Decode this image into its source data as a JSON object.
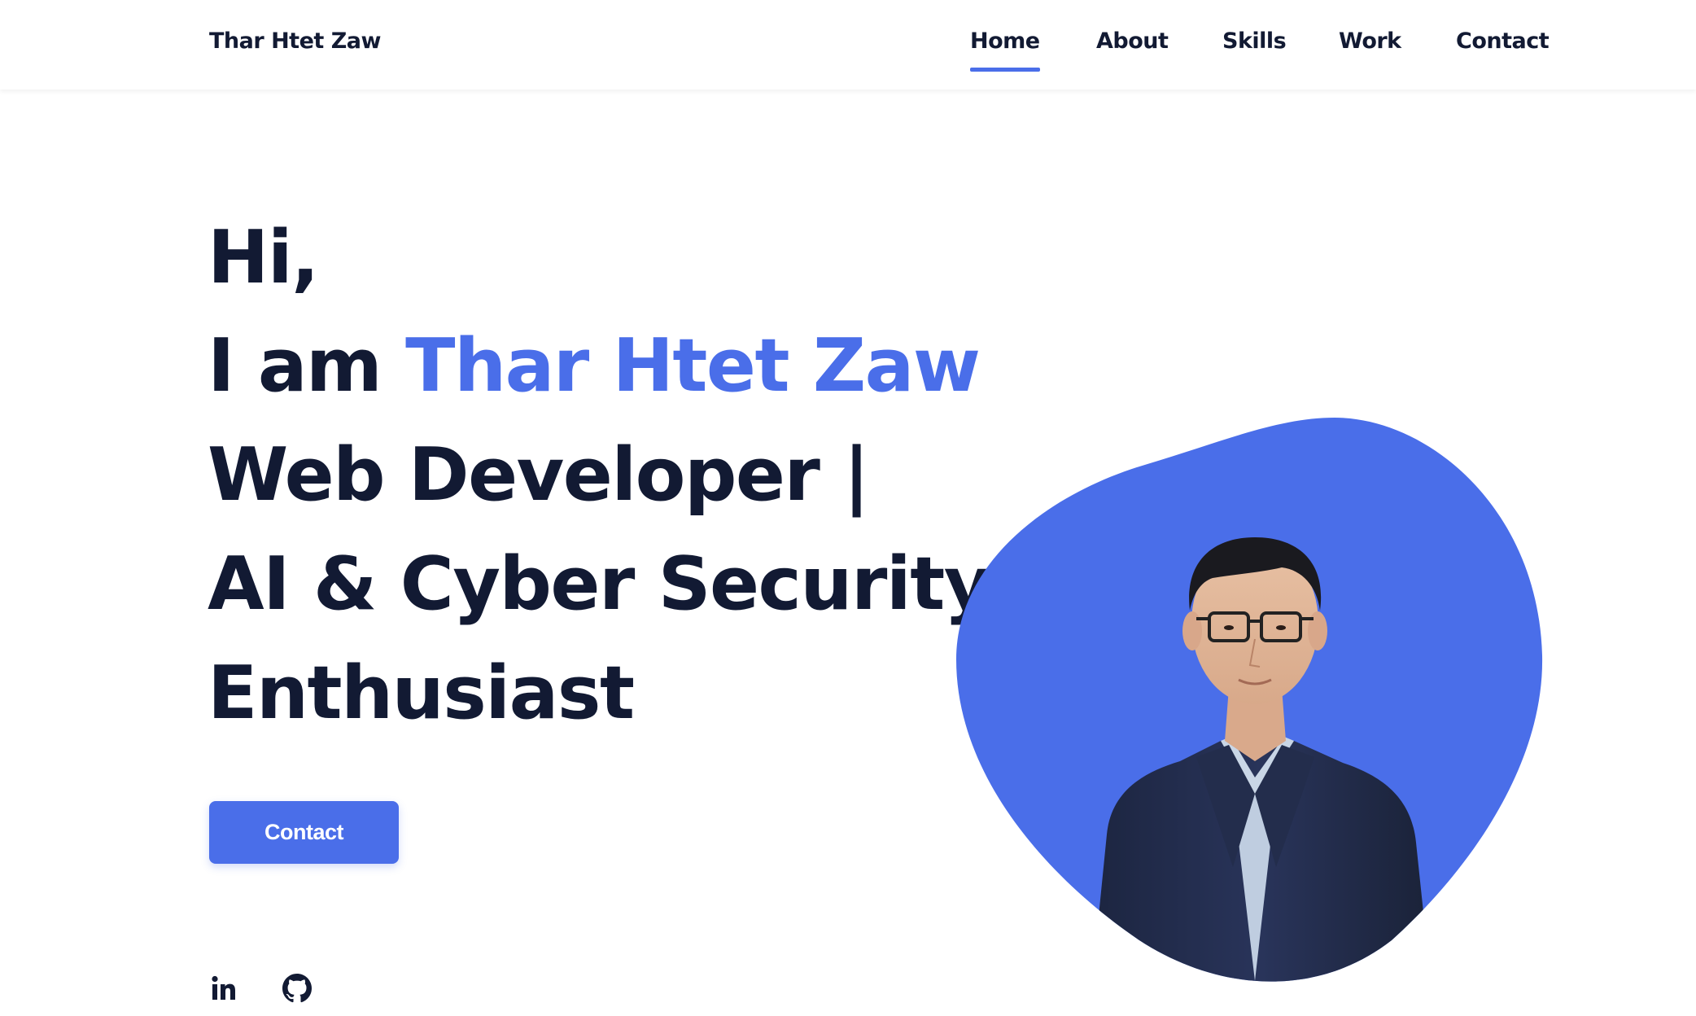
{
  "header": {
    "logo": "Thar Htet Zaw",
    "nav": [
      {
        "label": "Home",
        "active": true
      },
      {
        "label": "About",
        "active": false
      },
      {
        "label": "Skills",
        "active": false
      },
      {
        "label": "Work",
        "active": false
      },
      {
        "label": "Contact",
        "active": false
      }
    ]
  },
  "hero": {
    "greeting": "Hi,",
    "intro_prefix": "I am ",
    "name": "Thar Htet Zaw",
    "role_line1": "Web Developer |",
    "role_line2": "AI & Cyber Security",
    "role_line3": "Enthusiast",
    "contact_button": "Contact"
  },
  "social": [
    {
      "icon": "linkedin-icon"
    },
    {
      "icon": "github-icon"
    }
  ],
  "colors": {
    "accent": "#4a6ee9",
    "text": "#121a33",
    "background": "#ffffff"
  }
}
